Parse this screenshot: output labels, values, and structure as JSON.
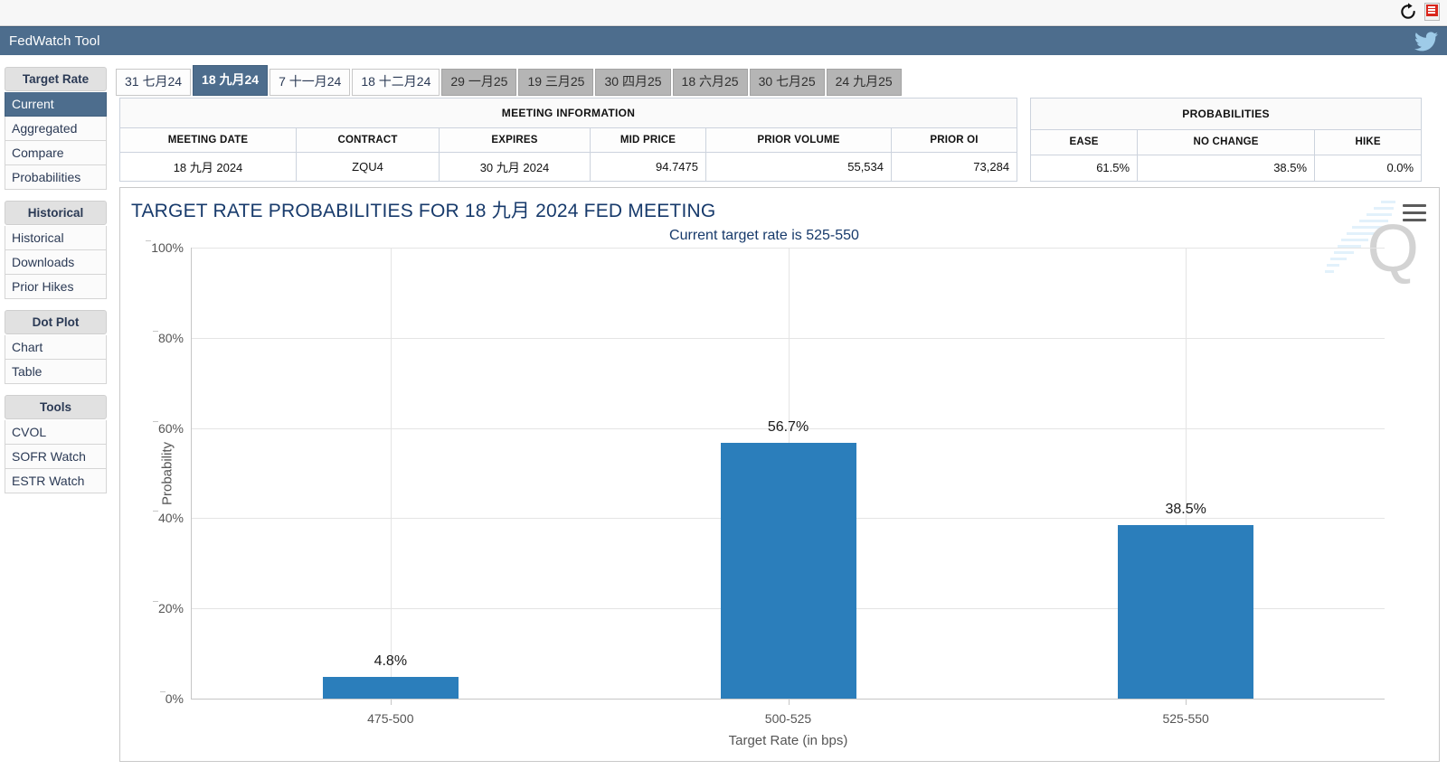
{
  "browser": {
    "reload_icon": "reload-icon",
    "pdf_icon": "pdf-icon"
  },
  "header": {
    "title": "FedWatch Tool",
    "social_icon": "twitter-icon"
  },
  "sidebar": {
    "groups": [
      {
        "title": "Target Rate",
        "items": [
          {
            "label": "Current",
            "active": true
          },
          {
            "label": "Aggregated",
            "active": false
          },
          {
            "label": "Compare",
            "active": false
          },
          {
            "label": "Probabilities",
            "active": false
          }
        ]
      },
      {
        "title": "Historical",
        "items": [
          {
            "label": "Historical",
            "active": false
          },
          {
            "label": "Downloads",
            "active": false
          },
          {
            "label": "Prior Hikes",
            "active": false
          }
        ]
      },
      {
        "title": "Dot Plot",
        "items": [
          {
            "label": "Chart",
            "active": false
          },
          {
            "label": "Table",
            "active": false
          }
        ]
      },
      {
        "title": "Tools",
        "items": [
          {
            "label": "CVOL",
            "active": false
          },
          {
            "label": "SOFR Watch",
            "active": false
          },
          {
            "label": "ESTR Watch",
            "active": false
          }
        ]
      }
    ]
  },
  "tabs": [
    {
      "label": "31 七月24",
      "state": "normal"
    },
    {
      "label": "18 九月24",
      "state": "active"
    },
    {
      "label": "7 十一月24",
      "state": "normal"
    },
    {
      "label": "18 十二月24",
      "state": "normal"
    },
    {
      "label": "29 一月25",
      "state": "disabled"
    },
    {
      "label": "19 三月25",
      "state": "disabled"
    },
    {
      "label": "30 四月25",
      "state": "disabled"
    },
    {
      "label": "18 六月25",
      "state": "disabled"
    },
    {
      "label": "30 七月25",
      "state": "disabled"
    },
    {
      "label": "24 九月25",
      "state": "disabled"
    }
  ],
  "meeting_information": {
    "group_title": "MEETING INFORMATION",
    "columns": [
      "MEETING DATE",
      "CONTRACT",
      "EXPIRES",
      "MID PRICE",
      "PRIOR VOLUME",
      "PRIOR OI"
    ],
    "row": {
      "meeting_date": "18 九月 2024",
      "contract": "ZQU4",
      "expires": "30 九月 2024",
      "mid_price": "94.7475",
      "prior_volume": "55,534",
      "prior_oi": "73,284"
    }
  },
  "probabilities_table": {
    "group_title": "PROBABILITIES",
    "columns": [
      "EASE",
      "NO CHANGE",
      "HIKE"
    ],
    "row": {
      "ease": "61.5%",
      "no_change": "38.5%",
      "hike": "0.0%"
    }
  },
  "chart_card": {
    "title": "TARGET RATE PROBABILITIES FOR 18 九月 2024 FED MEETING",
    "subtitle": "Current target rate is 525-550",
    "menu_icon": "hamburger-menu-icon",
    "watermark": "q-watermark"
  },
  "chart_data": {
    "type": "bar",
    "title": "TARGET RATE PROBABILITIES FOR 18 九月 2024 FED MEETING",
    "subtitle": "Current target rate is 525-550",
    "categories": [
      "475-500",
      "500-525",
      "525-550"
    ],
    "values": [
      4.8,
      56.7,
      38.5
    ],
    "value_labels": [
      "4.8%",
      "56.7%",
      "38.5%"
    ],
    "xlabel": "Target Rate (in bps)",
    "ylabel": "Probability",
    "ylim": [
      0,
      100
    ],
    "yticks": [
      0,
      20,
      40,
      60,
      80,
      100
    ],
    "ytick_labels": [
      "0%",
      "20%",
      "40%",
      "60%",
      "80%",
      "100%"
    ],
    "grid": true,
    "legend": false,
    "bar_color": "#2b7ebb"
  },
  "colors": {
    "header_blue": "#4d6d8d",
    "bar_blue": "#2b7ebb",
    "title_navy": "#173a6b",
    "tab_disabled_gray": "#b5b5b5"
  }
}
